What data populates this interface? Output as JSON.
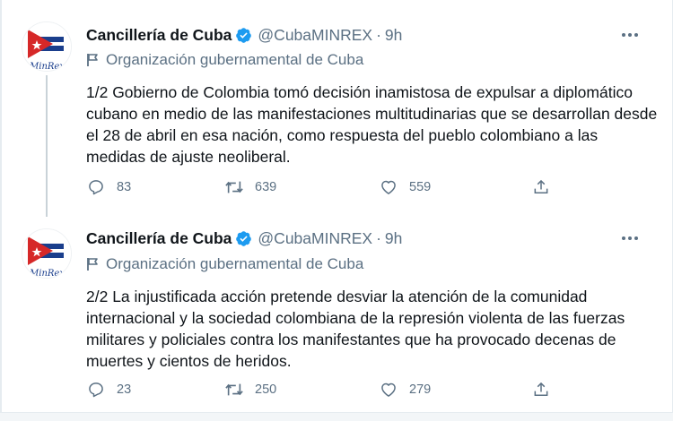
{
  "tweets": [
    {
      "name": "Cancillería de Cuba",
      "handle": "@CubaMINREX",
      "separator": "·",
      "time": "9h",
      "label": "Organización gubernamental de Cuba",
      "text": "1/2 Gobierno de Colombia tomó decisión inamistosa de expulsar a diplomático cubano en medio de las manifestaciones multitudinarias que se desarrollan desde el 28 de abril en esa nación, como respuesta del pueblo colombiano a las medidas de ajuste neoliberal.",
      "replies": "83",
      "retweets": "639",
      "likes": "559"
    },
    {
      "name": "Cancillería de Cuba",
      "handle": "@CubaMINREX",
      "separator": "·",
      "time": "9h",
      "label": "Organización gubernamental de Cuba",
      "text": "2/2 La injustificada acción pretende desviar la atención de la comunidad internacional y la sociedad colombiana de la represión violenta de las fuerzas militares y policiales contra los manifestantes que ha provocado decenas de muertes y cientos de heridos.",
      "replies": "23",
      "retweets": "250",
      "likes": "279"
    }
  ],
  "avatar_logo_text": "MinRex",
  "colors": {
    "verified": "#1d9bf0",
    "secondary_text": "#5b7083",
    "flag_red": "#d62828",
    "flag_blue": "#1a3e8c"
  },
  "icons": [
    "verified-badge-icon",
    "more-icon",
    "flag-icon",
    "reply-icon",
    "retweet-icon",
    "like-icon",
    "share-icon"
  ]
}
